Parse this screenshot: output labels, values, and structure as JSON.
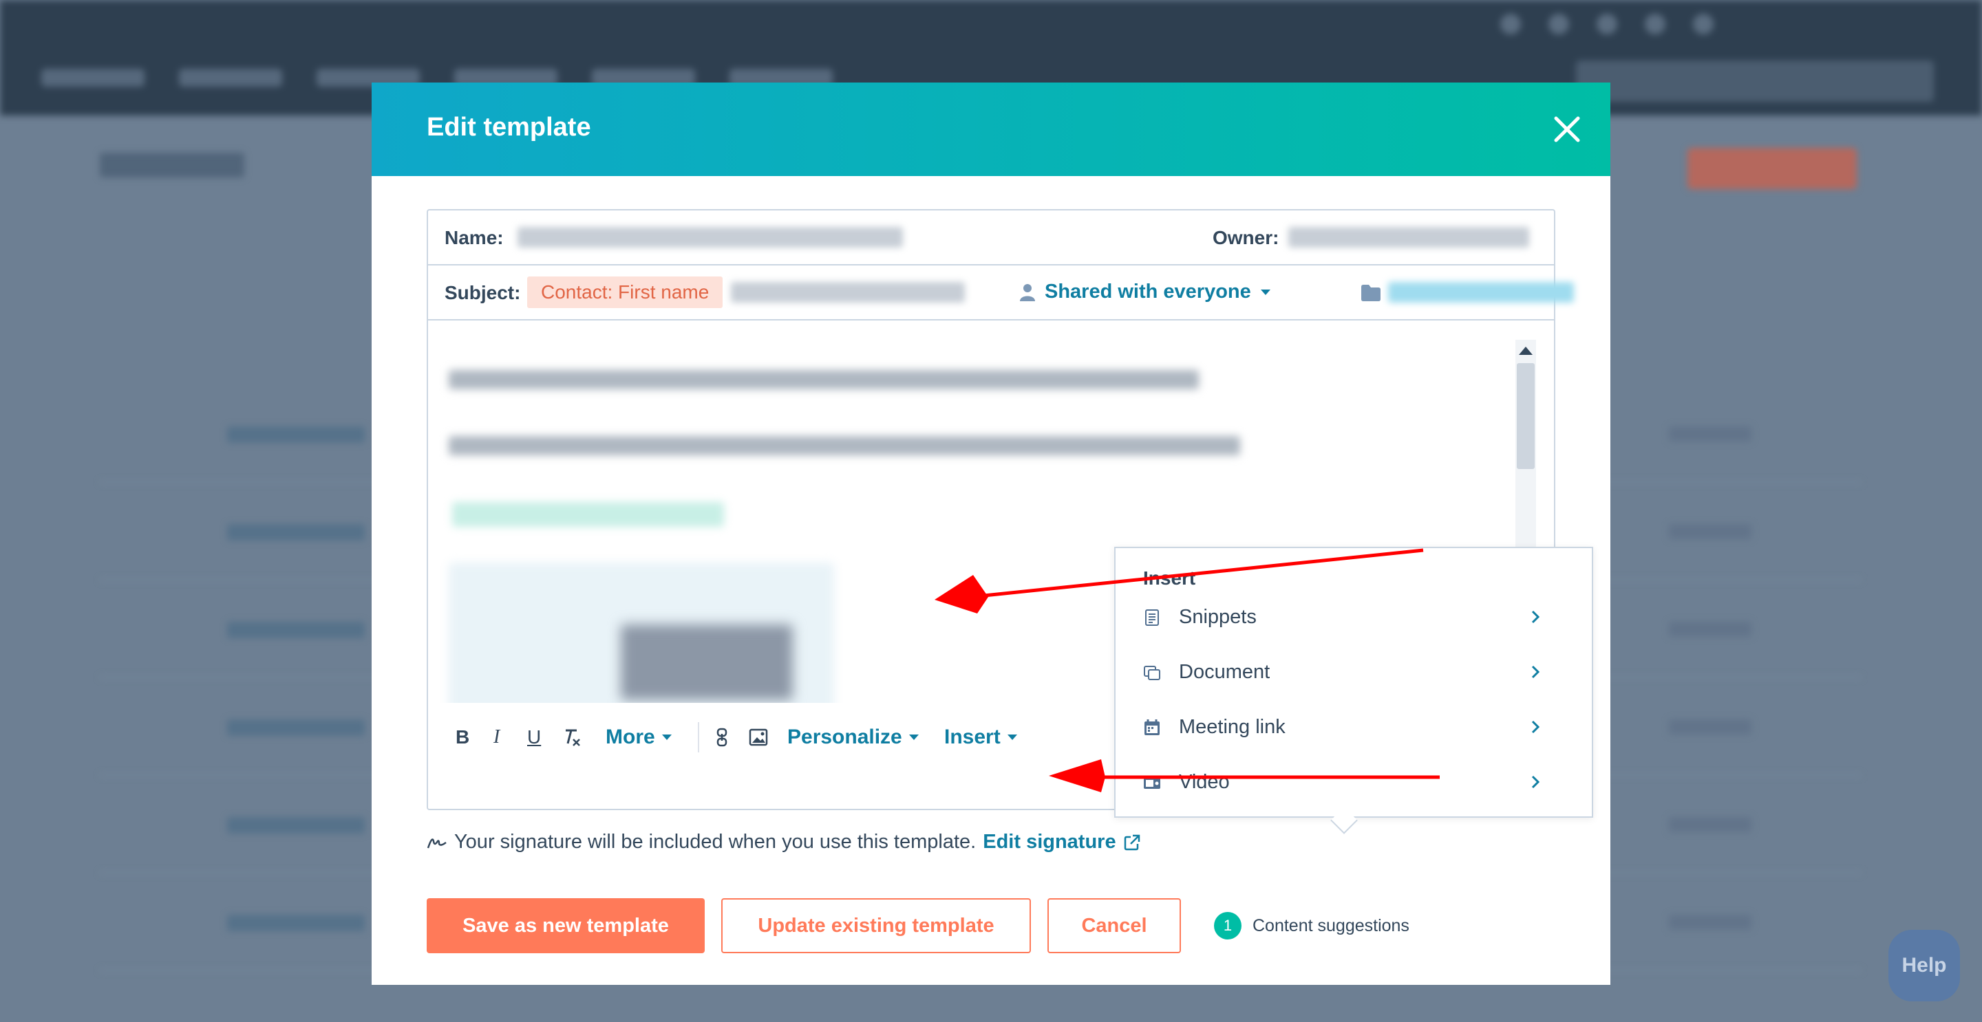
{
  "background": {
    "help_label": "Help"
  },
  "modal": {
    "title": "Edit template",
    "name_label": "Name:",
    "owner_label": "Owner:",
    "subject_label": "Subject:",
    "subject_token": "Contact: First name",
    "shared_label": "Shared with everyone"
  },
  "toolbar": {
    "bold": "B",
    "italic": "I",
    "underline": "U",
    "more_label": "More",
    "personalize_label": "Personalize",
    "insert_label": "Insert"
  },
  "insert_menu": {
    "header": "Insert",
    "items": [
      {
        "label": "Snippets",
        "icon": "snippets-icon"
      },
      {
        "label": "Document",
        "icon": "document-icon"
      },
      {
        "label": "Meeting link",
        "icon": "calendar-icon"
      },
      {
        "label": "Video",
        "icon": "video-icon"
      }
    ]
  },
  "signature": {
    "text": "Your signature will be included when you use this template.",
    "link": "Edit signature"
  },
  "footer": {
    "save_new": "Save as new template",
    "update_existing": "Update existing template",
    "cancel": "Cancel",
    "suggestion_count": "1",
    "suggestion_label": "Content suggestions"
  },
  "colors": {
    "header_gradient_start": "#0fa7c9",
    "header_gradient_end": "#00bda5",
    "primary": "#ff7a59",
    "link": "#0f7ea2",
    "annotation_arrow": "#ff0000"
  }
}
